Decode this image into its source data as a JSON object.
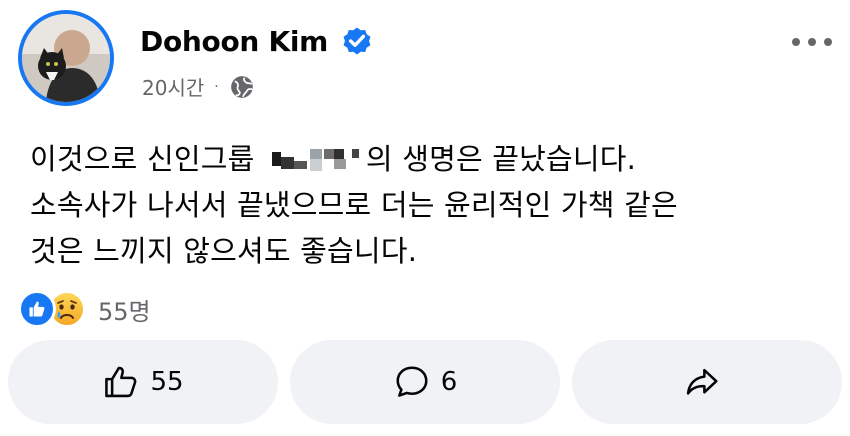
{
  "post": {
    "author": "Dohoon Kim",
    "verified": true,
    "time": "20시간",
    "separator": "·",
    "audience_icon": "globe-icon",
    "menu_icon": "more-horizontal-icon",
    "content": {
      "line1_before": "이것으로 신인그룹 ",
      "line1_after": "의 생명은 끝났습니다.",
      "line2": "소속사가 나서서 끝냈으므로 더는 윤리적인 가책 같은",
      "line3": "것은 느끼지 않으셔도 좋습니다."
    },
    "reactions": {
      "icons": [
        "like-reaction-icon",
        "sad-reaction-icon"
      ],
      "count_label": "55명"
    },
    "actions": {
      "like": {
        "icon": "thumbs-up-icon",
        "label": "55"
      },
      "comment": {
        "icon": "comment-bubble-icon",
        "label": "6"
      },
      "share": {
        "icon": "share-arrow-icon",
        "label": ""
      }
    },
    "colors": {
      "accent": "#1877f2",
      "secondary_text": "#65676b",
      "button_bg": "#f0f2f5"
    }
  }
}
